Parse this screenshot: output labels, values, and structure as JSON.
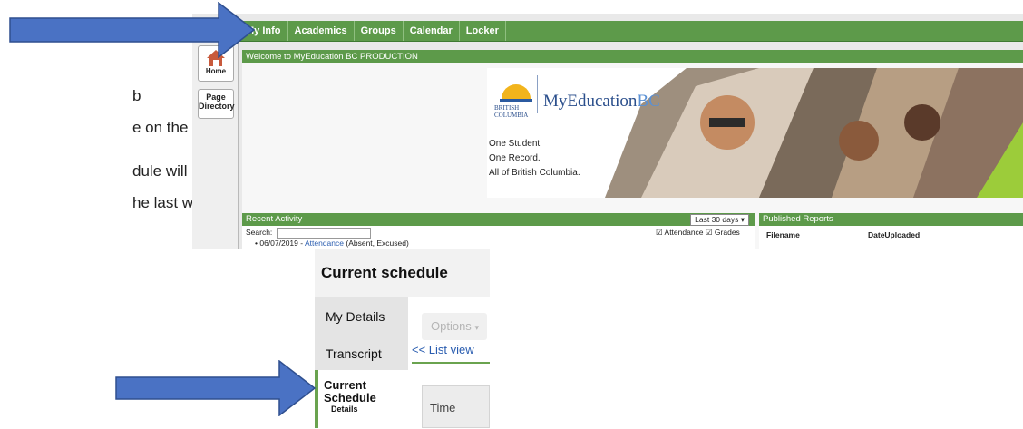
{
  "instructions": {
    "line1": "b",
    "line2": "e on the side",
    "line3": "dule will be",
    "line4": "he last week"
  },
  "app": {
    "nav_tabs": [
      "My Info",
      "Academics",
      "Groups",
      "Calendar",
      "Locker"
    ],
    "side_buttons": {
      "home": "Home",
      "page_directory_1": "Page",
      "page_directory_2": "Directory"
    },
    "welcome": "Welcome to MyEducation BC PRODUCTION",
    "banner": {
      "province_1": "BRITISH",
      "province_2": "COLUMBIA",
      "brand_main": "MyEducation",
      "brand_bc": "BC",
      "tagline_1": "One Student.",
      "tagline_2": "One Record.",
      "tagline_3": "All of British Columbia."
    },
    "recent": {
      "title": "Recent Activity",
      "range": "Last 30 days",
      "search_label": "Search:",
      "attendance_label": "Attendance",
      "grades_label": "Grades",
      "entry_date": "06/07/2019 - ",
      "entry_link": "Attendance",
      "entry_note": " (Absent, Excused)"
    },
    "reports": {
      "title": "Published Reports",
      "col_filename": "Filename",
      "col_date": "DateUploaded"
    }
  },
  "schedule": {
    "title": "Current schedule",
    "side_items": {
      "details": "My Details",
      "transcript": "Transcript",
      "current_1": "Current",
      "current_2": "Schedule",
      "current_sub": "Details"
    },
    "options": "Options",
    "list_view": "<< List view",
    "time_header": "Time"
  },
  "colors": {
    "arrow": "#4a72c4",
    "nav_green": "#5d9a4a",
    "link_blue": "#2a5db0"
  }
}
